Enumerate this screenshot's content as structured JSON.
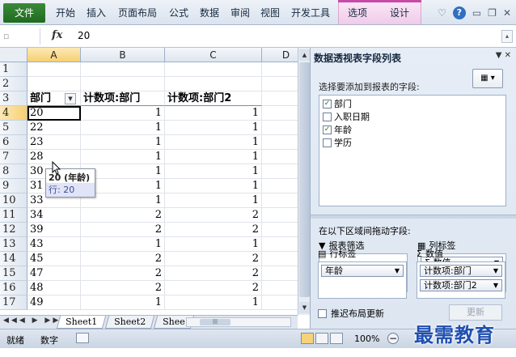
{
  "ribbon": {
    "tabs": [
      "文件",
      "开始",
      "插入",
      "页面布局",
      "公式",
      "数据",
      "审阅",
      "视图",
      "开发工具",
      "选项",
      "设计"
    ]
  },
  "formula_bar": {
    "fx": "fx",
    "value": "20"
  },
  "grid": {
    "columns": [
      "A",
      "B",
      "C",
      "D"
    ],
    "rows": [
      "1",
      "2",
      "3",
      "4",
      "5",
      "6",
      "7",
      "8",
      "9",
      "10",
      "11",
      "12",
      "13",
      "14",
      "15",
      "16",
      "17"
    ],
    "header_row": [
      "部门",
      "计数项:部门",
      "计数项:部门2"
    ],
    "data": [
      [
        "20",
        "1",
        "1"
      ],
      [
        "22",
        "1",
        "1"
      ],
      [
        "23",
        "1",
        "1"
      ],
      [
        "28",
        "1",
        "1"
      ],
      [
        "30",
        "1",
        "1"
      ],
      [
        "31",
        "1",
        "1"
      ],
      [
        "33",
        "1",
        "1"
      ],
      [
        "34",
        "2",
        "2"
      ],
      [
        "39",
        "2",
        "2"
      ],
      [
        "43",
        "1",
        "1"
      ],
      [
        "45",
        "2",
        "2"
      ],
      [
        "47",
        "2",
        "2"
      ],
      [
        "48",
        "2",
        "2"
      ],
      [
        "49",
        "1",
        "1"
      ]
    ]
  },
  "tooltip": {
    "line1": "20 (年龄)",
    "line2": "行: 20"
  },
  "sheets": [
    "Sheet1",
    "Sheet2",
    "Shee"
  ],
  "pivot": {
    "title": "数据透视表字段列表",
    "choose_label": "选择要添加到报表的字段:",
    "fields": [
      {
        "label": "部门",
        "checked": true
      },
      {
        "label": "入职日期",
        "checked": false
      },
      {
        "label": "年龄",
        "checked": true
      },
      {
        "label": "学历",
        "checked": false
      }
    ],
    "drag_label": "在以下区域间拖动字段:",
    "filter_label": "报表筛选",
    "column_label": "列标签",
    "row_label": "行标签",
    "values_label": "数值",
    "column_items": [
      "Σ 数值"
    ],
    "row_items": [
      "年龄"
    ],
    "value_items": [
      "计数项:部门",
      "计数项:部门2"
    ],
    "defer_label": "推迟布局更新",
    "update_label": "更新"
  },
  "status": {
    "ready": "就绪",
    "num": "数字",
    "zoom": "100%"
  },
  "watermark": "最需教育",
  "colors": {
    "file_tab": "#1f6b1f",
    "context_tab": "#c64aa8",
    "selection": "#f6cf71"
  }
}
